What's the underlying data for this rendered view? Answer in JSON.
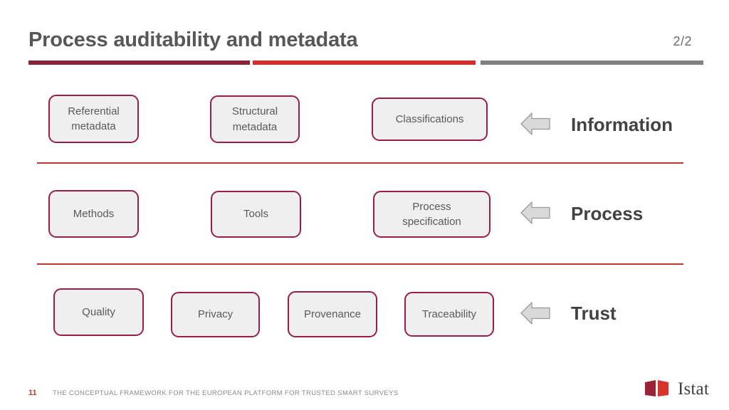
{
  "header": {
    "title": "Process auditability and metadata",
    "counter": "2/2",
    "rule_colors": [
      "#8c2238",
      "#d92c29",
      "#808080"
    ]
  },
  "bands": [
    {
      "label": "Information",
      "arrow_icon": "arrow-left-icon",
      "nodes": [
        {
          "label": "Referential\nmetadata"
        },
        {
          "label": "Structural\nmetadata"
        },
        {
          "label": "Classifications"
        }
      ]
    },
    {
      "label": "Process",
      "arrow_icon": "arrow-left-icon",
      "nodes": [
        {
          "label": "Methods"
        },
        {
          "label": "Tools"
        },
        {
          "label": "Process\nspecification"
        }
      ]
    },
    {
      "label": "Trust",
      "arrow_icon": "arrow-left-icon",
      "nodes": [
        {
          "label": "Quality"
        },
        {
          "label": "Privacy"
        },
        {
          "label": "Provenance"
        },
        {
          "label": "Traceability"
        }
      ]
    }
  ],
  "footer": {
    "page_number": "11",
    "text": "THE CONCEPTUAL FRAMEWORK FOR THE EUROPEAN PLATFORM FOR TRUSTED SMART SURVEYS",
    "logo_text": "Istat",
    "logo_colors": [
      "#9b2335",
      "#d7352c"
    ]
  },
  "theme": {
    "node_fill": "#efefef",
    "node_border": "#9c1e42",
    "separator": "#c0392f",
    "arrow_fill": "#d9d9d9",
    "arrow_border": "#9a9a9a",
    "label_color": "#424242"
  }
}
